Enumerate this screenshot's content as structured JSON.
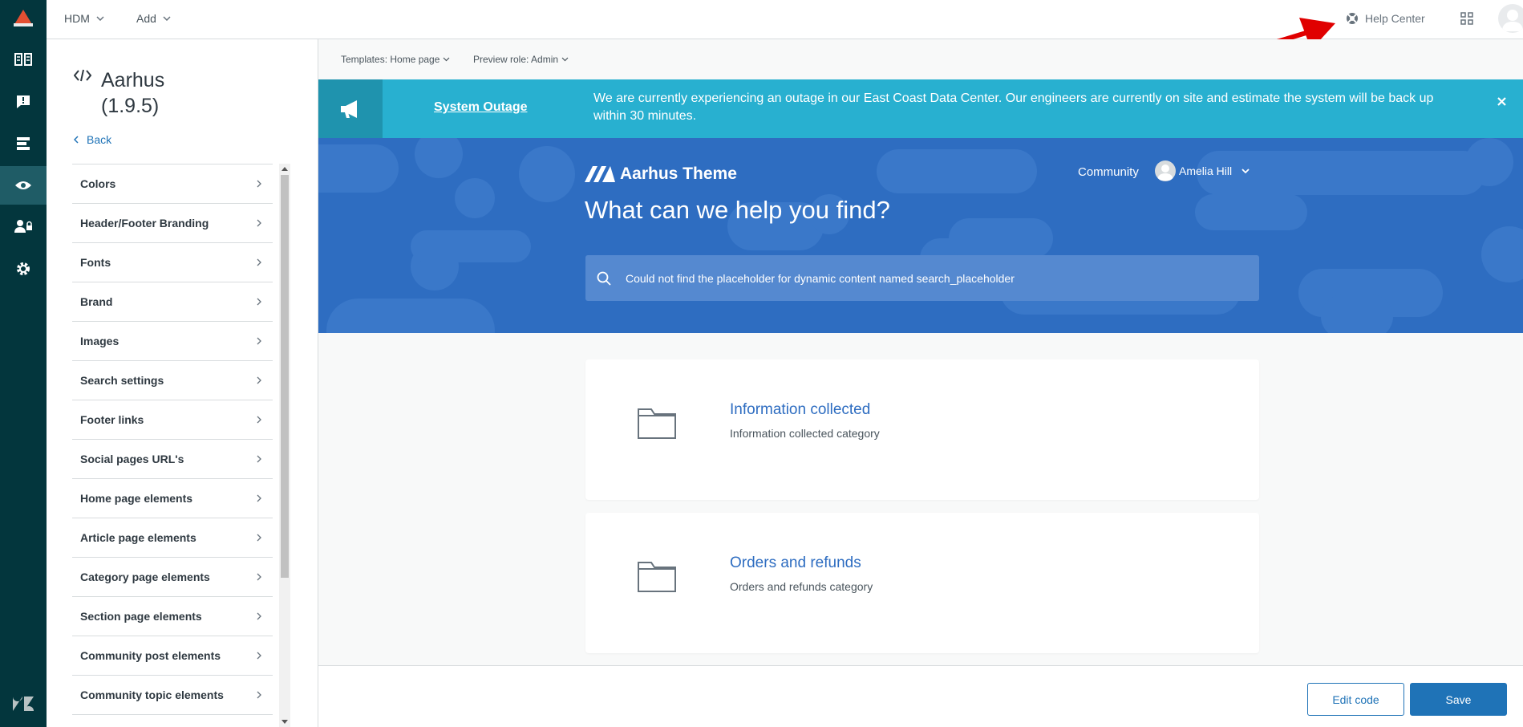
{
  "topbar": {
    "menu_hdm": "HDM",
    "menu_add": "Add",
    "help_center": "Help Center"
  },
  "panel": {
    "theme_name": "Aarhus",
    "theme_version": "(1.9.5)",
    "back_label": "Back",
    "settings": [
      "Colors",
      "Header/Footer Branding",
      "Fonts",
      "Brand",
      "Images",
      "Search settings",
      "Footer links",
      "Social pages URL's",
      "Home page elements",
      "Article page elements",
      "Category page elements",
      "Section page elements",
      "Community post elements",
      "Community topic elements"
    ]
  },
  "preview": {
    "template_label": "Templates: Home page",
    "role_label": "Preview role: Admin",
    "banner": {
      "title": "System Outage",
      "message": "We are currently experiencing an outage in our East Coast Data Center. Our engineers are currently on site and estimate the system will be back up within 30 minutes."
    },
    "hero": {
      "brand": "Aarhus Theme",
      "nav_community": "Community",
      "user_name": "Amelia Hill",
      "headline": "What can we help you find?",
      "search_placeholder": "Could not find the placeholder for dynamic content named search_placeholder"
    },
    "categories": [
      {
        "title": "Information collected",
        "description": "Information collected category"
      },
      {
        "title": "Orders and refunds",
        "description": "Orders and refunds category"
      }
    ]
  },
  "footer": {
    "edit_code": "Edit code",
    "save": "Save"
  },
  "colors": {
    "rail": "#03363d",
    "banner": "#28b0d0",
    "hero": "#2e6dc1",
    "primary": "#1f73b7",
    "annotation_arrow": "#e00000"
  }
}
